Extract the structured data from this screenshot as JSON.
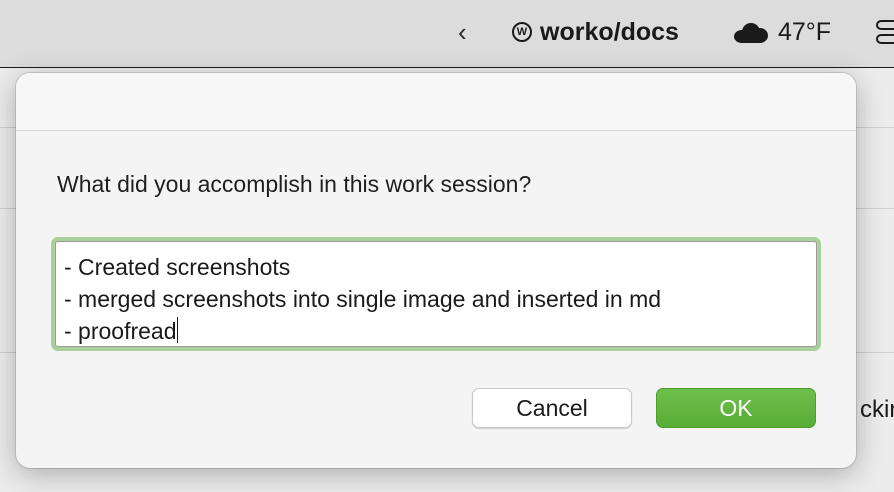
{
  "menubar": {
    "app_name": "worko/docs",
    "temperature": "47°F"
  },
  "background": {
    "right_fragment": "ckir"
  },
  "dialog": {
    "prompt": "What did you accomplish in this work session?",
    "text_value": "- Created screenshots\n- merged screenshots into single image and inserted in md\n- proofread",
    "cancel_label": "Cancel",
    "ok_label": "OK"
  },
  "colors": {
    "ok_button": "#5cb23a",
    "focus_ring": "#a9d09a"
  }
}
